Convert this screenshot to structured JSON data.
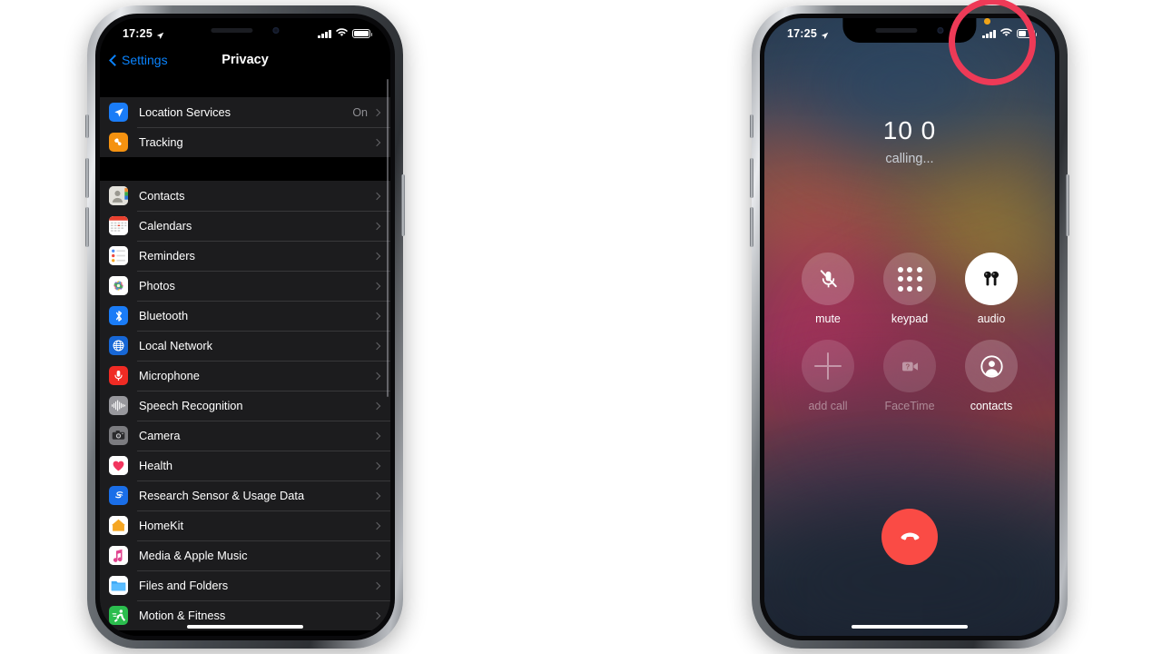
{
  "left_phone": {
    "status_bar": {
      "time": "17:25",
      "location_icon": "location-arrow-icon",
      "signal_icon": "cellular-bars-icon",
      "wifi_icon": "wifi-icon",
      "battery_icon": "battery-icon",
      "battery_level_pct": 100
    },
    "nav": {
      "back_label": "Settings",
      "back_icon": "chevron-left-icon",
      "title": "Privacy"
    },
    "groups": [
      {
        "rows": [
          {
            "label": "Location Services",
            "value": "On",
            "icon": "location-services-icon",
            "icon_color": "#1a7cf7"
          },
          {
            "label": "Tracking",
            "value": "",
            "icon": "tracking-icon",
            "icon_color": "#f59210"
          }
        ]
      },
      {
        "rows": [
          {
            "label": "Contacts",
            "value": "",
            "icon": "contacts-icon",
            "icon_color": "#dedcd6"
          },
          {
            "label": "Calendars",
            "value": "",
            "icon": "calendars-icon",
            "icon_color": "#ffffff"
          },
          {
            "label": "Reminders",
            "value": "",
            "icon": "reminders-icon",
            "icon_color": "#ffffff"
          },
          {
            "label": "Photos",
            "value": "",
            "icon": "photos-icon",
            "icon_color": "#ffffff"
          },
          {
            "label": "Bluetooth",
            "value": "",
            "icon": "bluetooth-icon",
            "icon_color": "#1a7cf7"
          },
          {
            "label": "Local Network",
            "value": "",
            "icon": "local-network-icon",
            "icon_color": "#1767d6"
          },
          {
            "label": "Microphone",
            "value": "",
            "icon": "microphone-icon",
            "icon_color": "#f02b24"
          },
          {
            "label": "Speech Recognition",
            "value": "",
            "icon": "speech-recognition-icon",
            "icon_color": "#9a9a9f"
          },
          {
            "label": "Camera",
            "value": "",
            "icon": "camera-icon",
            "icon_color": "#8e8e93"
          },
          {
            "label": "Health",
            "value": "",
            "icon": "health-icon",
            "icon_color": "#ffffff"
          },
          {
            "label": "Research Sensor & Usage Data",
            "value": "",
            "icon": "research-sensor-icon",
            "icon_color": "#1a6ee8"
          },
          {
            "label": "HomeKit",
            "value": "",
            "icon": "homekit-icon",
            "icon_color": "#ffffff"
          },
          {
            "label": "Media & Apple Music",
            "value": "",
            "icon": "media-apple-music-icon",
            "icon_color": "#ffffff"
          },
          {
            "label": "Files and Folders",
            "value": "",
            "icon": "files-and-folders-icon",
            "icon_color": "#ffffff"
          },
          {
            "label": "Motion & Fitness",
            "value": "",
            "icon": "motion-fitness-icon",
            "icon_color": "#2bbd4e"
          }
        ]
      }
    ]
  },
  "right_phone": {
    "status_bar": {
      "time": "17:25",
      "location_icon": "location-arrow-icon",
      "mic_indicator": "microphone-privacy-dot",
      "mic_indicator_color": "#f0a318",
      "signal_icon": "cellular-bars-icon",
      "wifi_icon": "wifi-icon",
      "battery_icon": "battery-icon",
      "battery_level_pct": 52
    },
    "call": {
      "callee": "10 0",
      "status": "calling...",
      "buttons": [
        {
          "label": "mute",
          "icon": "microphone-slash-icon",
          "state": "enabled"
        },
        {
          "label": "keypad",
          "icon": "keypad-grid-icon",
          "state": "enabled"
        },
        {
          "label": "audio",
          "icon": "airpods-icon",
          "state": "active"
        },
        {
          "label": "add call",
          "icon": "plus-icon",
          "state": "disabled"
        },
        {
          "label": "FaceTime",
          "icon": "facetime-video-icon",
          "state": "disabled"
        },
        {
          "label": "contacts",
          "icon": "contacts-person-icon",
          "state": "enabled"
        }
      ],
      "end_call": {
        "label": "",
        "icon": "end-call-handset-icon",
        "color": "#fa4b45"
      }
    }
  },
  "annotation": {
    "shape": "circle-highlight",
    "color": "#ee3a57",
    "target": "microphone-privacy-dot"
  }
}
